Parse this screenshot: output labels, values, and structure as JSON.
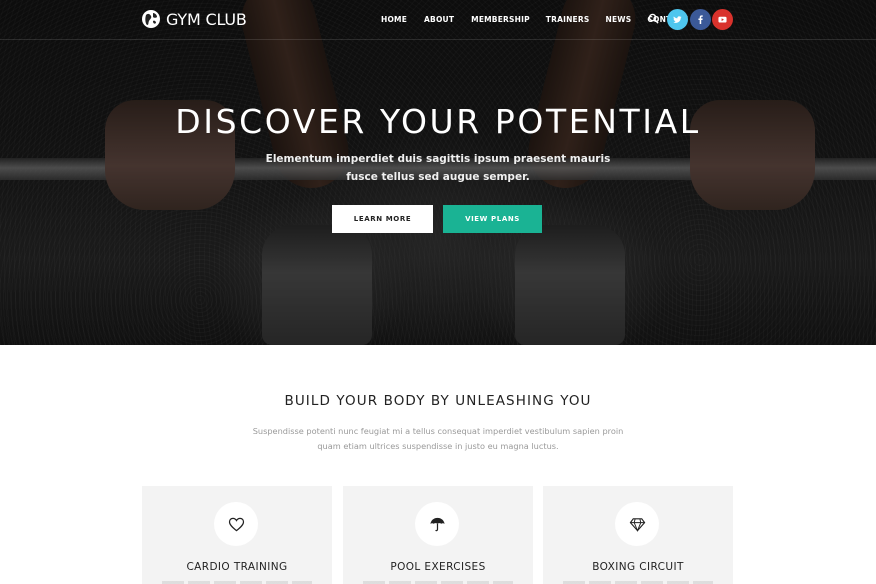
{
  "nav": {
    "logo_text": "GYM CLUB",
    "logo_icon": "globe-dumbbell-icon",
    "items": [
      {
        "label": "HOME"
      },
      {
        "label": "ABOUT"
      },
      {
        "label": "MEMBERSHIP"
      },
      {
        "label": "TRAINERS"
      },
      {
        "label": "NEWS"
      },
      {
        "label": "CONTACT"
      }
    ],
    "search_icon": "search-icon",
    "social": [
      {
        "name": "twitter-icon",
        "color": "#4ec6ee"
      },
      {
        "name": "facebook-icon",
        "color": "#3b5998"
      },
      {
        "name": "youtube-icon",
        "color": "#d9322c"
      }
    ]
  },
  "hero": {
    "title": "DISCOVER YOUR POTENTIAL",
    "subtitle_line1": "Elementum imperdiet duis sagittis ipsum praesent mauris",
    "subtitle_line2": "fusce tellus sed augue semper.",
    "learn_more_label": "LEARN MORE",
    "view_plans_label": "VIEW PLANS",
    "accent_color": "#1ab394"
  },
  "features": {
    "title": "BUILD YOUR BODY BY UNLEASHING YOU",
    "description_line1": "Suspendisse potenti nunc feugiat mi a tellus consequat imperdiet vestibulum sapien proin",
    "description_line2": "quam etiam ultrices suspendisse in justo eu magna luctus.",
    "cards": [
      {
        "title": "CARDIO TRAINING",
        "icon": "heart-icon"
      },
      {
        "title": "POOL EXERCISES",
        "icon": "umbrella-icon"
      },
      {
        "title": "BOXING CIRCUIT",
        "icon": "diamond-icon"
      }
    ]
  }
}
